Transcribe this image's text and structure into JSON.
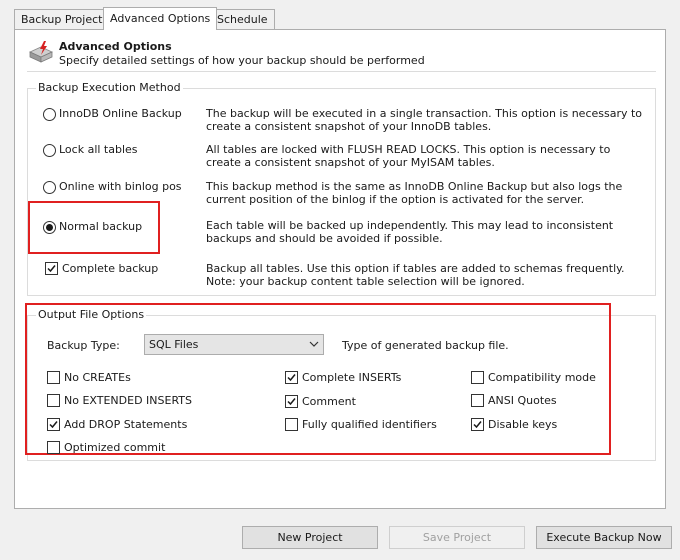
{
  "tabs": [
    {
      "label": "Backup Project"
    },
    {
      "label": "Advanced Options"
    },
    {
      "label": "Schedule"
    }
  ],
  "header": {
    "title": "Advanced Options",
    "subtitle": "Specify detailed settings of how your backup should be performed",
    "icon": "backup-database-icon"
  },
  "execution": {
    "group_title": "Backup Execution Method",
    "options": [
      {
        "label": "InnoDB Online Backup",
        "selected": false,
        "desc": "The backup will be executed in a single transaction. This option is necessary to create a consistent snapshot of your InnoDB tables."
      },
      {
        "label": "Lock all tables",
        "selected": false,
        "desc": "All tables are locked with FLUSH READ LOCKS. This option is necessary to create a consistent snapshot of your MyISAM tables."
      },
      {
        "label": "Online with binlog pos",
        "selected": false,
        "desc": "This backup method is the same as InnoDB Online Backup but also logs the current position of the binlog if the option is activated for the server."
      },
      {
        "label": "Normal backup",
        "selected": true,
        "desc": "Each table will be backed up independently. This may lead to inconsistent backups and should be avoided if possible."
      }
    ],
    "complete_backup": {
      "label": "Complete backup",
      "checked": true,
      "desc": "Backup all tables. Use this option if tables are added to schemas frequently. Note: your backup content table selection will be ignored."
    }
  },
  "output": {
    "group_title": "Output File Options",
    "backup_type_label": "Backup Type:",
    "backup_type_value": "SQL Files",
    "backup_type_desc": "Type of generated backup file.",
    "checkboxes": [
      {
        "label": "No CREATEs",
        "checked": false
      },
      {
        "label": "Complete INSERTs",
        "checked": true
      },
      {
        "label": "Compatibility mode",
        "checked": false
      },
      {
        "label": "No EXTENDED INSERTS",
        "checked": false
      },
      {
        "label": "Comment",
        "checked": true
      },
      {
        "label": "ANSI Quotes",
        "checked": false
      },
      {
        "label": "Add DROP Statements",
        "checked": true
      },
      {
        "label": "Fully qualified identifiers",
        "checked": false
      },
      {
        "label": "Disable keys",
        "checked": true
      },
      {
        "label": "Optimized commit",
        "checked": false
      }
    ]
  },
  "buttons": {
    "new_project": "New Project",
    "save_project": "Save Project",
    "execute": "Execute Backup Now"
  },
  "colors": {
    "highlight": "#e02020",
    "accent": "#d62020"
  }
}
